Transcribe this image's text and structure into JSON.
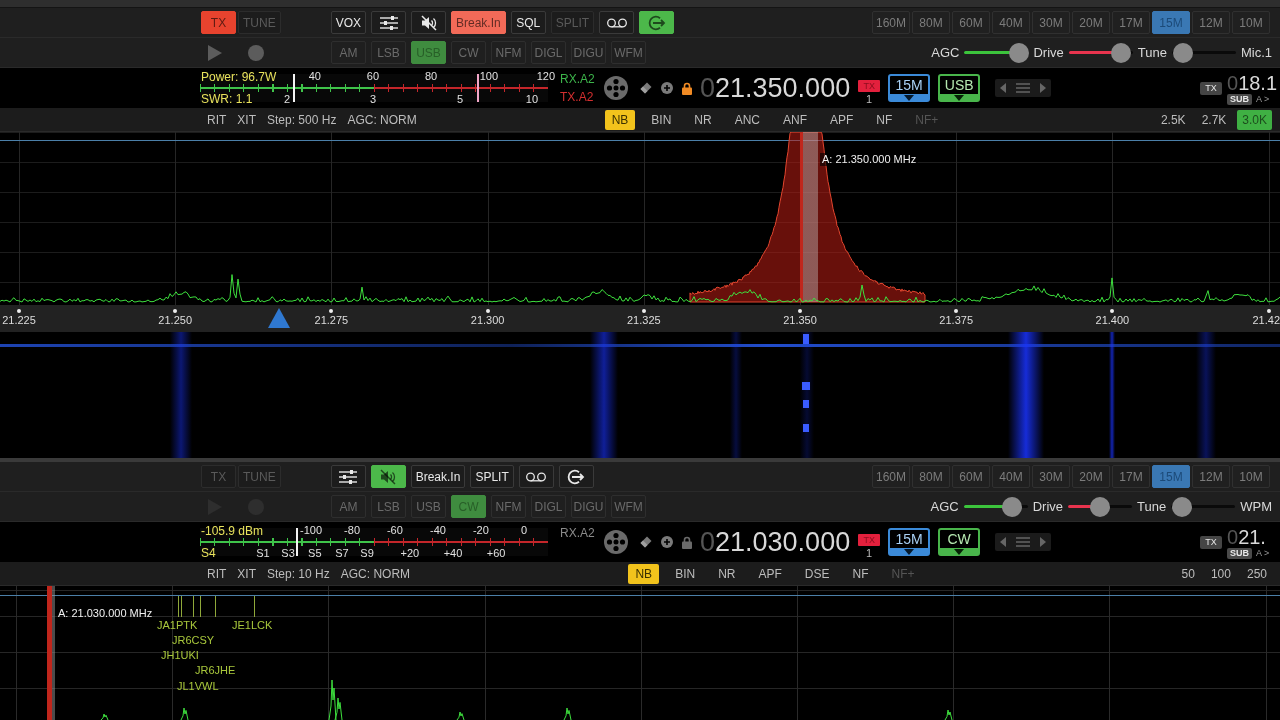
{
  "receivers": [
    {
      "tx_buttons": [
        {
          "label": "TX",
          "on": true,
          "color": "#e8432e",
          "disabled": false
        },
        {
          "label": "TUNE",
          "on": false,
          "disabled": true
        }
      ],
      "function_buttons": [
        {
          "kind": "text",
          "label": "VOX",
          "on": false,
          "disabled": false
        },
        {
          "kind": "sliders",
          "on": false,
          "disabled": false
        },
        {
          "kind": "mute",
          "on": false,
          "disabled": false
        },
        {
          "kind": "text",
          "label": "Break.In",
          "on": true,
          "color": "#f26a58",
          "disabled": false
        },
        {
          "kind": "text",
          "label": "SQL",
          "on": false,
          "disabled": false
        },
        {
          "kind": "text",
          "label": "SPLIT",
          "on": false,
          "disabled": true
        },
        {
          "kind": "tape",
          "on": false,
          "disabled": false
        },
        {
          "kind": "exit",
          "on": true,
          "color": "#4cb84a",
          "disabled": false
        }
      ],
      "bands": [
        {
          "label": "160M",
          "selected": false
        },
        {
          "label": "80M",
          "selected": false
        },
        {
          "label": "60M",
          "selected": false
        },
        {
          "label": "40M",
          "selected": false
        },
        {
          "label": "30M",
          "selected": false
        },
        {
          "label": "20M",
          "selected": false
        },
        {
          "label": "17M",
          "selected": false
        },
        {
          "label": "15M",
          "selected": true
        },
        {
          "label": "12M",
          "selected": false
        },
        {
          "label": "10M",
          "selected": false
        }
      ],
      "transport": [
        {
          "kind": "play",
          "disabled": false
        },
        {
          "kind": "record",
          "disabled": false
        }
      ],
      "modes": [
        {
          "label": "AM",
          "selected": false
        },
        {
          "label": "LSB",
          "selected": false
        },
        {
          "label": "USB",
          "selected": true
        },
        {
          "label": "CW",
          "selected": false
        },
        {
          "label": "NFM",
          "selected": false
        },
        {
          "label": "DIGL",
          "selected": false
        },
        {
          "label": "DIGU",
          "selected": false
        },
        {
          "label": "WFM",
          "selected": false
        }
      ],
      "sliders": [
        {
          "label": "AGC",
          "level": 0.85,
          "color": "#3cc43c"
        },
        {
          "label": "Drive",
          "level": 0.82,
          "color": "#e8344e"
        },
        {
          "label": "Tune",
          "level": 0.17
        }
      ],
      "slider_end_label": "Mic.1",
      "meter": {
        "kind": "power",
        "top_label": "Power: 96.7W",
        "top_scale": [
          "40",
          "60",
          "80",
          "100",
          "120"
        ],
        "bottom_label": "SWR: 1.1",
        "bottom_scale": [
          "2",
          "3",
          "5",
          "10"
        ],
        "needles": [
          {
            "kind": "peak",
            "level": 0.27
          },
          {
            "kind": "power",
            "level": 0.8
          }
        ]
      },
      "antennas": [
        {
          "kind": "rx",
          "label": "RX.A2",
          "active": true
        },
        {
          "kind": "tx",
          "label": "TX.A2",
          "active": true
        }
      ],
      "locked": true,
      "frequency": "021.350.000",
      "tx_badge": "TX",
      "vfo_number": "1",
      "band_dropdown": "15M",
      "mode_dropdown": "USB",
      "sub_tx_badge": "TX",
      "sub_frequency": "018.1",
      "sub_badge": "SUB",
      "swap_label": "A >",
      "tuning_controls": [
        "RIT",
        "XIT",
        "Step: 500 Hz",
        "AGC: NORM"
      ],
      "dsp_buttons": [
        {
          "label": "NB",
          "on": true,
          "disabled": false
        },
        {
          "label": "BIN",
          "on": false,
          "disabled": false
        },
        {
          "label": "NR",
          "on": false,
          "disabled": false
        },
        {
          "label": "ANC",
          "on": false,
          "disabled": false
        },
        {
          "label": "ANF",
          "on": false,
          "disabled": false
        },
        {
          "label": "APF",
          "on": false,
          "disabled": false
        },
        {
          "label": "NF",
          "on": false,
          "disabled": false
        },
        {
          "label": "NF+",
          "on": false,
          "disabled": true
        }
      ],
      "filters": [
        {
          "label": "2.5K",
          "selected": false
        },
        {
          "label": "2.7K",
          "selected": false
        },
        {
          "label": "3.0K",
          "selected": true
        }
      ],
      "spectrum": {
        "vfo_label": "A: 21.350.000 MHz",
        "axis_ticks": [
          "21.225",
          "21.250",
          "21.275",
          "21.300",
          "21.325",
          "21.350",
          "21.375",
          "21.400",
          "21.42"
        ],
        "waterfall": true
      }
    },
    {
      "tx_buttons": [
        {
          "label": "TX",
          "on": false,
          "disabled": true
        },
        {
          "label": "TUNE",
          "on": false,
          "disabled": true
        }
      ],
      "function_buttons": [
        {
          "kind": "sliders",
          "on": false,
          "disabled": false
        },
        {
          "kind": "mute",
          "on": true,
          "color": "#4cb84a",
          "disabled": false
        },
        {
          "kind": "text",
          "label": "Break.In",
          "on": false,
          "disabled": false
        },
        {
          "kind": "text",
          "label": "SPLIT",
          "on": false,
          "disabled": false
        },
        {
          "kind": "tape",
          "on": false,
          "disabled": false
        },
        {
          "kind": "exit",
          "on": false,
          "disabled": false
        }
      ],
      "bands": [
        {
          "label": "160M",
          "selected": false
        },
        {
          "label": "80M",
          "selected": false
        },
        {
          "label": "60M",
          "selected": false
        },
        {
          "label": "40M",
          "selected": false
        },
        {
          "label": "30M",
          "selected": false
        },
        {
          "label": "20M",
          "selected": false
        },
        {
          "label": "17M",
          "selected": false
        },
        {
          "label": "15M",
          "selected": true
        },
        {
          "label": "12M",
          "selected": false
        },
        {
          "label": "10M",
          "selected": false
        }
      ],
      "transport": [
        {
          "kind": "play",
          "disabled": true
        },
        {
          "kind": "record",
          "disabled": true
        }
      ],
      "modes": [
        {
          "label": "AM",
          "selected": false
        },
        {
          "label": "LSB",
          "selected": false
        },
        {
          "label": "USB",
          "selected": false
        },
        {
          "label": "CW",
          "selected": true
        },
        {
          "label": "NFM",
          "selected": false
        },
        {
          "label": "DIGL",
          "selected": false
        },
        {
          "label": "DIGU",
          "selected": false
        },
        {
          "label": "WFM",
          "selected": false
        }
      ],
      "sliders": [
        {
          "label": "AGC",
          "level": 0.75,
          "color": "#3cc43c"
        },
        {
          "label": "Drive",
          "level": 0.5,
          "color": "#e8344e"
        },
        {
          "label": "Tune",
          "level": 0.17
        }
      ],
      "slider_end_label": "WPM",
      "meter": {
        "kind": "signal",
        "top_label": "-105.9 dBm",
        "top_scale": [
          "-100",
          "-80",
          "-60",
          "-40",
          "-20",
          "0"
        ],
        "bottom_label": "S4",
        "bottom_scale": [
          "S1",
          "S3",
          "S5",
          "S7",
          "S9",
          "+20",
          "+40",
          "+60"
        ],
        "needles": [
          {
            "kind": "signal",
            "level": 0.28
          }
        ]
      },
      "antennas": [
        {
          "kind": "rx",
          "label": "RX.A2",
          "active": false
        }
      ],
      "locked": false,
      "frequency": "021.030.000",
      "tx_badge": "TX",
      "vfo_number": "1",
      "band_dropdown": "15M",
      "mode_dropdown": "CW",
      "sub_tx_badge": "TX",
      "sub_frequency": "021.",
      "sub_badge": "SUB",
      "swap_label": "A >",
      "tuning_controls": [
        "RIT",
        "XIT",
        "Step: 10 Hz",
        "AGC: NORM"
      ],
      "dsp_buttons": [
        {
          "label": "NB",
          "on": true,
          "disabled": false
        },
        {
          "label": "BIN",
          "on": false,
          "disabled": false
        },
        {
          "label": "NR",
          "on": false,
          "disabled": false
        },
        {
          "label": "APF",
          "on": false,
          "disabled": false
        },
        {
          "label": "DSE",
          "on": false,
          "disabled": false
        },
        {
          "label": "NF",
          "on": false,
          "disabled": false
        },
        {
          "label": "NF+",
          "on": false,
          "disabled": true
        }
      ],
      "filters": [
        {
          "label": "50",
          "selected": false
        },
        {
          "label": "100",
          "selected": false
        },
        {
          "label": "250",
          "selected": false
        }
      ],
      "spectrum": {
        "vfo_label": "A: 21.030.000 MHz",
        "spots": [
          "JA1PTK",
          "JE1LCK",
          "JR6CSY",
          "JH1UKI",
          "JR6JHE",
          "JL1VWL"
        ]
      }
    }
  ]
}
